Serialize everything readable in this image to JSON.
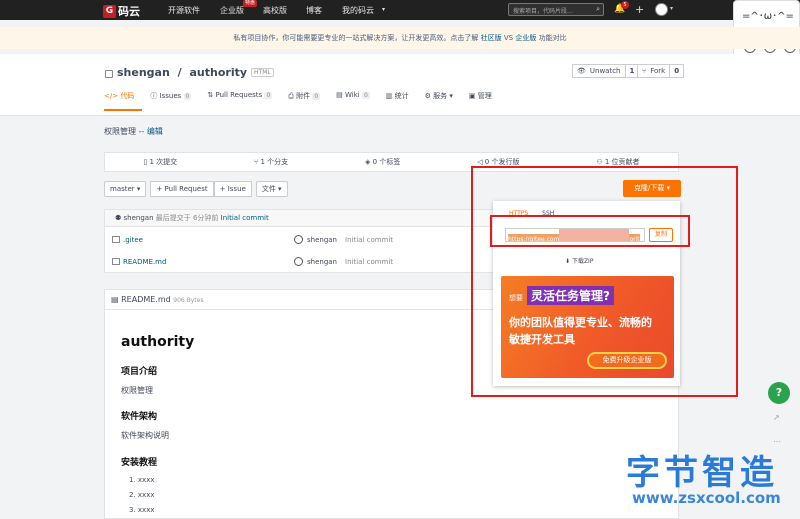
{
  "topnav": {
    "logo": "码云",
    "links": [
      "开源软件",
      "企业版",
      "高校版",
      "博客",
      "我的码云"
    ],
    "hot_badge": "特惠",
    "search_placeholder": "搜索项目，代码片段...",
    "notif_count": "5"
  },
  "notice": {
    "text": "私有项目协作，你可能需要更专业的一站式解决方案，让开发更高效。点击了解",
    "link1": "社区版",
    "vs": "VS",
    "link2": "企业版",
    "tail": "功能对比"
  },
  "repo": {
    "owner": "shengan",
    "sep": " / ",
    "name": "authority",
    "lang": "HTML",
    "unwatch_label": "Unwatch",
    "unwatch_count": "1",
    "fork_label": "Fork",
    "fork_count": "0"
  },
  "tabs": [
    {
      "label": "代码",
      "count": ""
    },
    {
      "label": "Issues",
      "count": "0"
    },
    {
      "label": "Pull Requests",
      "count": "0"
    },
    {
      "label": "附件",
      "count": "0"
    },
    {
      "label": "Wiki",
      "count": "0"
    },
    {
      "label": "统计",
      "count": ""
    },
    {
      "label": "服务",
      "count": ""
    },
    {
      "label": "管理",
      "count": ""
    }
  ],
  "description": {
    "text": "权限管理 --",
    "edit": "编辑"
  },
  "stats": [
    "1 次提交",
    "1 个分支",
    "0 个标签",
    "0 个发行版",
    "1 位贡献者"
  ],
  "toolbar": {
    "branch": "master",
    "pull_request": "+ Pull Request",
    "issue": "+ Issue",
    "file": "文件"
  },
  "commit": {
    "author": "shengan",
    "time": "最后提交于 6分钟前",
    "message": "Initial commit"
  },
  "files": [
    {
      "name": ".gitee",
      "user": "shengan",
      "message": "Initial commit"
    },
    {
      "name": "README.md",
      "user": "shengan",
      "message": "Initial commit"
    }
  ],
  "readme": {
    "filename": "README.md",
    "size": "906 Bytes",
    "h1": "authority",
    "sec1_title": "项目介绍",
    "sec1_text": "权限管理",
    "sec2_title": "软件架构",
    "sec2_text": "软件架构说明",
    "sec3_title": "安装教程",
    "items": [
      "1. xxxx",
      "2. xxxx",
      "3. xxxx"
    ]
  },
  "clone": {
    "button": "克隆/下载",
    "tab_https": "HTTPS",
    "tab_ssh": "SSH",
    "url": "https://gitee.com",
    "url_tail": "orit",
    "copy": "复制",
    "zip": "下载ZIP"
  },
  "banner": {
    "lead": "想要",
    "title": "灵活任务管理?",
    "sub": "你的团队值得更专业、流畅的敏捷开发工具",
    "cta": "免费升级企业版"
  },
  "help": "?",
  "watermark": {
    "cn": "字节智造",
    "url": "www.zsxcool.com"
  }
}
